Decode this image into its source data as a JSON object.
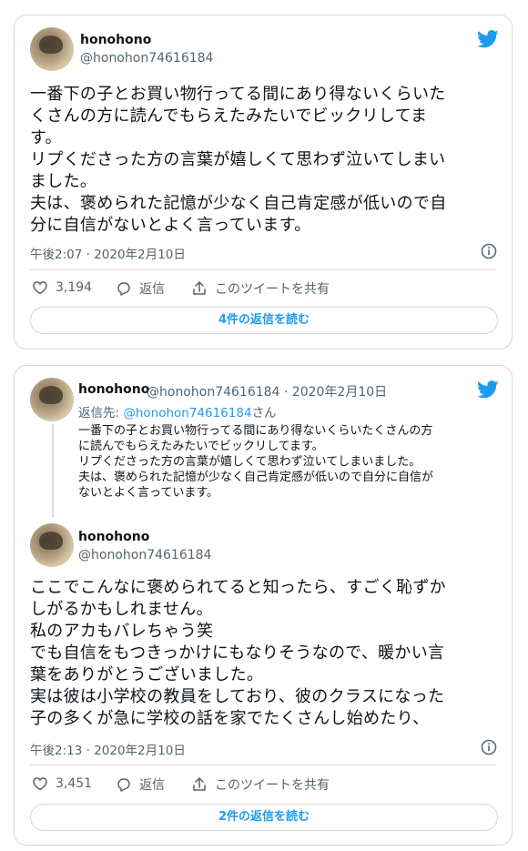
{
  "brand": {
    "accent": "#1d9bf0",
    "text": "#0f1419",
    "muted": "#536471",
    "border": "#cfd9de"
  },
  "tweet1": {
    "author_name": "honohono",
    "author_handle": "@honohon74616184",
    "text": "一番下の子とお買い物行ってる間にあり得ないくらいた\nくさんの方に読んでもらえたみたいでビックリしてま\nす。\nリプくださった方の言葉が嬉しくて思わず泣いてしまい\nました。\n夫は、褒められた記憶が少なく自己肯定感が低いので自\n分に自信がないとよく言っています。",
    "timestamp": "午後2:07 · 2020年2月10日",
    "like_count": "3,194",
    "reply_label": "返信",
    "share_label": "このツイートを共有",
    "read_replies": "4件の返信を読む",
    "icons": {
      "bird": "twitter-bird-icon",
      "info": "info-icon",
      "like": "heart-icon",
      "reply": "reply-icon",
      "share": "share-icon"
    }
  },
  "tweet2": {
    "parent": {
      "author_name": "honohono",
      "author_meta": "@honohon74616184 · 2020年2月10日",
      "reply_prefix": "返信先: ",
      "reply_handle": "@honohon74616184",
      "reply_suffix": "さん",
      "text": "一番下の子とお買い物行ってる間にあり得ないくらいたくさんの方\nに読んでもらえたみたいでビックリしてます。\nリプくださった方の言葉が嬉しくて思わず泣いてしまいました。\n夫は、褒められた記憶が少なく自己肯定感が低いので自分に自信が\nないとよく言っています。"
    },
    "author_name": "honohono",
    "author_handle": "@honohon74616184",
    "text": "ここでこんなに褒められてると知ったら、すごく恥ずか\nしがるかもしれません。\n私のアカもバレちゃう笑\nでも自信をもつきっかけにもなりそうなので、暖かい言\n葉をありがとうございました。\n実は彼は小学校の教員をしており、彼のクラスになった\n子の多くが急に学校の話を家でたくさんし始めたり、",
    "timestamp": "午後2:13 · 2020年2月10日",
    "like_count": "3,451",
    "reply_label": "返信",
    "share_label": "このツイートを共有",
    "read_replies": "2件の返信を読む"
  }
}
